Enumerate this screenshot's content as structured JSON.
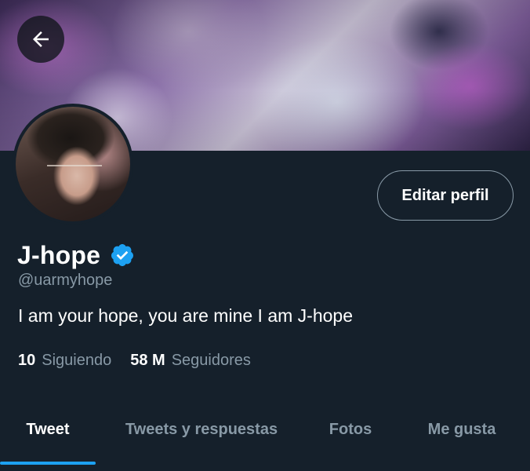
{
  "profile": {
    "name": "J-hope",
    "handle": "@uarmyhope",
    "bio": "I am your hope, you are mine I am J-hope",
    "following_count": "10",
    "following_label": "Siguiendo",
    "followers_count": "58 M",
    "followers_label": "Seguidores",
    "verified": true
  },
  "actions": {
    "edit_label": "Editar perfil",
    "back_icon": "arrow-left-icon"
  },
  "tabs": [
    {
      "label": "Tweet",
      "active": true
    },
    {
      "label": "Tweets y respuestas",
      "active": false
    },
    {
      "label": "Fotos",
      "active": false
    },
    {
      "label": "Me gusta",
      "active": false
    }
  ],
  "colors": {
    "background": "#15202b",
    "accent": "#1da1f2",
    "muted_text": "#8899a6",
    "text": "#ffffff"
  }
}
